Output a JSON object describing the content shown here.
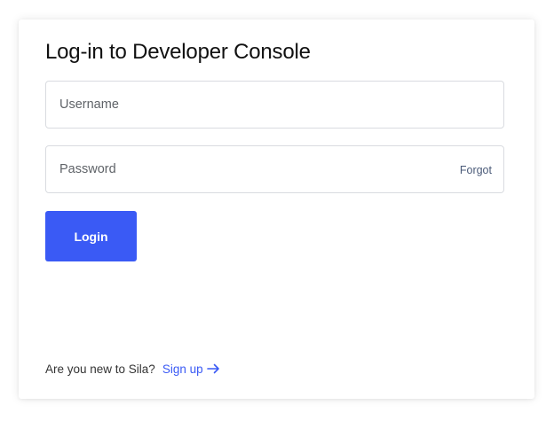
{
  "login": {
    "title": "Log-in to Developer Console",
    "username": {
      "placeholder": "Username",
      "value": ""
    },
    "password": {
      "placeholder": "Password",
      "value": ""
    },
    "forgot_label": "Forgot",
    "login_label": "Login",
    "footer": {
      "prompt": "Are you new to Sila?",
      "signup_label": "Sign up",
      "signup_icon": "arrow-right-icon"
    }
  },
  "colors": {
    "accent": "#3a5af5",
    "field_border": "#d9dbe0",
    "forgot_text": "#4a5a78"
  }
}
